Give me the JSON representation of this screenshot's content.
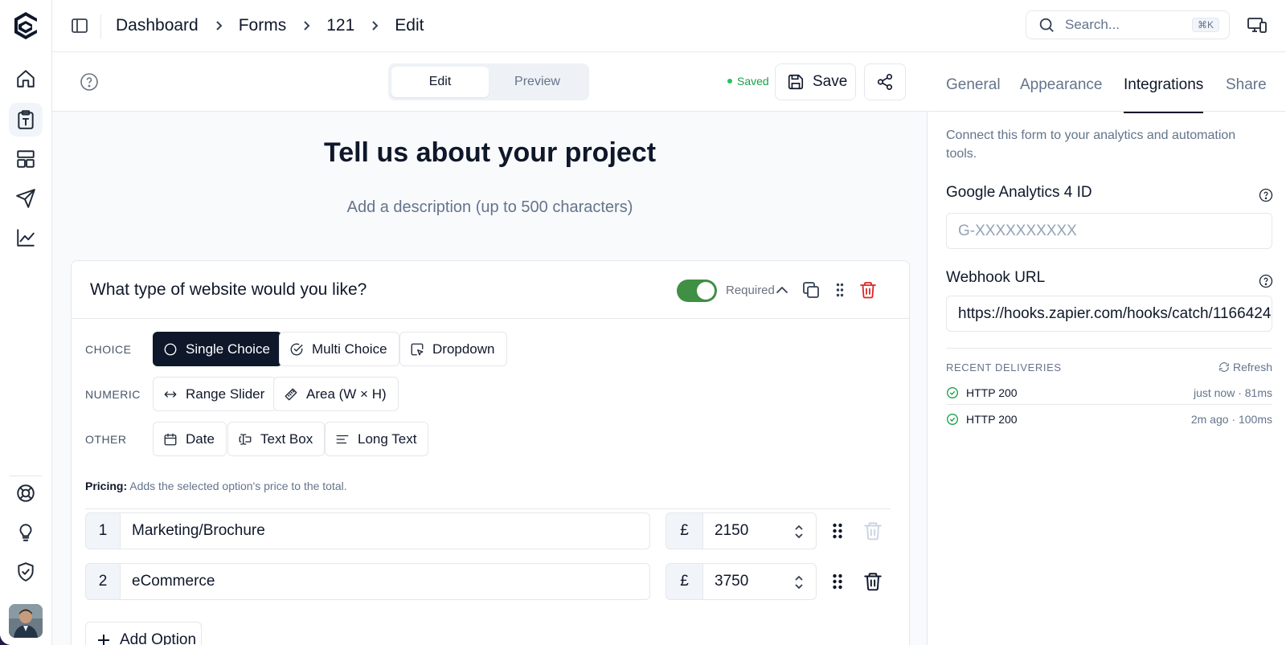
{
  "breadcrumbs": [
    "Dashboard",
    "Forms",
    "121",
    "Edit"
  ],
  "search": {
    "placeholder": "Search...",
    "shortcut": "⌘K"
  },
  "toolbar": {
    "tabs": [
      "Edit",
      "Preview"
    ],
    "active_tab": "Edit",
    "saved_label": "Saved",
    "save_label": "Save"
  },
  "form": {
    "title": "Tell us about your project",
    "description_placeholder": "Add a description (up to 500 characters)"
  },
  "question": {
    "title": "What type of website would you like?",
    "required_label": "Required",
    "required": true,
    "rows": [
      {
        "label": "CHOICE",
        "types": [
          "Single Choice",
          "Multi Choice",
          "Dropdown"
        ]
      },
      {
        "label": "NUMERIC",
        "types": [
          "Range Slider",
          "Area (W × H)"
        ]
      },
      {
        "label": "OTHER",
        "types": [
          "Date",
          "Text Box",
          "Long Text"
        ]
      }
    ],
    "selected_type": "Single Choice",
    "pricing_label": "Pricing:",
    "pricing_text": "Adds the selected option's price to the total.",
    "options": [
      {
        "num": "1",
        "label": "Marketing/Brochure",
        "currency": "£",
        "price": "2150"
      },
      {
        "num": "2",
        "label": "eCommerce",
        "currency": "£",
        "price": "3750"
      }
    ],
    "add_option_label": "Add Option"
  },
  "panel": {
    "tabs": [
      "General",
      "Appearance",
      "Integrations",
      "Share"
    ],
    "active_tab": "Integrations",
    "description": "Connect this form to your analytics and automation tools.",
    "ga_label": "Google Analytics 4 ID",
    "ga_placeholder": "G-XXXXXXXXXX",
    "webhook_label": "Webhook URL",
    "webhook_value": "https://hooks.zapier.com/hooks/catch/1166424",
    "recent_title": "RECENT DELIVERIES",
    "refresh_label": "Refresh",
    "deliveries": [
      {
        "status": "HTTP 200",
        "meta": "just now · 81ms"
      },
      {
        "status": "HTTP 200",
        "meta": "2m ago · 100ms"
      }
    ]
  },
  "colors": {
    "accent_dark": "#0f172a",
    "toggle_on": "#3f8f45",
    "success": "#16a34a",
    "danger": "#dc2626"
  }
}
